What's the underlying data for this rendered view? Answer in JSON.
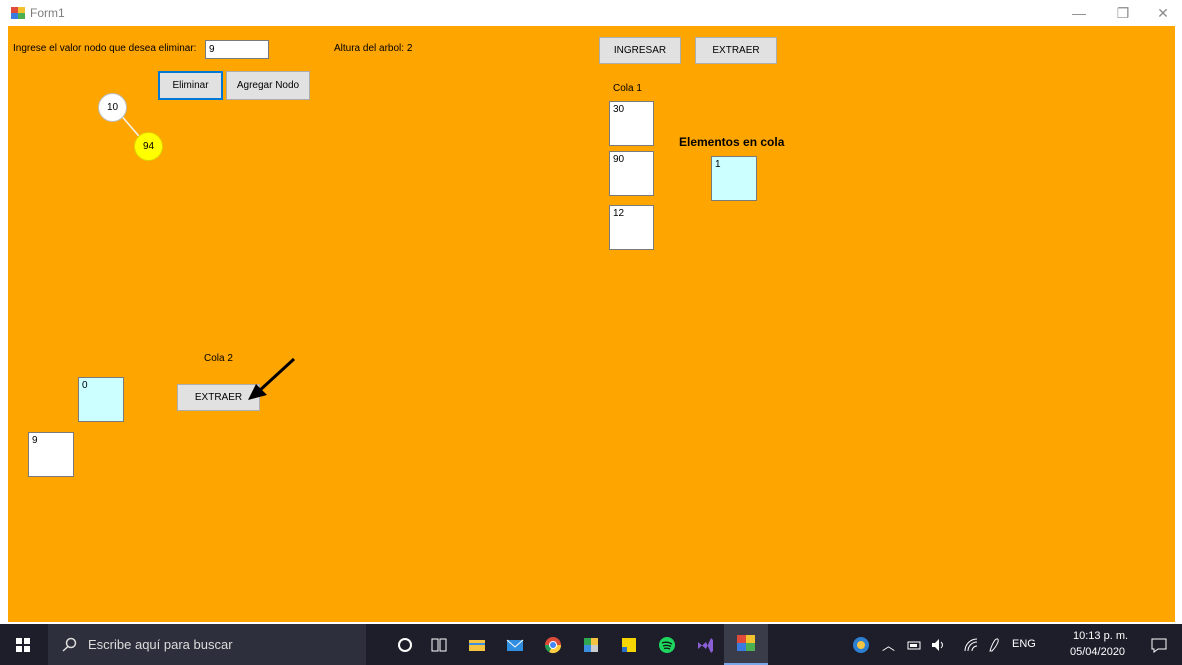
{
  "window": {
    "title": "Form1",
    "minimize": "—",
    "restore": "❐",
    "close": "✕"
  },
  "form": {
    "delete_prompt": "Ingrese el valor nodo que desea eliminar:",
    "delete_value": "9",
    "tree_height_label": "Altura del arbol:  2",
    "delete_button": "Eliminar",
    "add_node_button": "Agregar Nodo",
    "enqueue_button": "INGRESAR",
    "dequeue_button": "EXTRAER",
    "tree_nodes": [
      "10",
      "94"
    ],
    "cola1": {
      "label": "Cola 1",
      "items": [
        "30",
        "90",
        "12"
      ]
    },
    "count": {
      "label": "Elementos en cola",
      "value": "1"
    },
    "cola2": {
      "label": "Cola 2",
      "extract_button": "EXTRAER",
      "items": [
        "0",
        "9"
      ]
    }
  },
  "taskbar": {
    "search_placeholder": "Escribe aquí para buscar",
    "language": "ENG",
    "time": "10:13 p. m.",
    "date": "05/04/2020"
  },
  "colors": {
    "form_bg": "#ffa500",
    "taskbar_bg": "#1d1e2a",
    "node_highlight": "#ffff00",
    "queue_cyan": "#ccffff"
  }
}
